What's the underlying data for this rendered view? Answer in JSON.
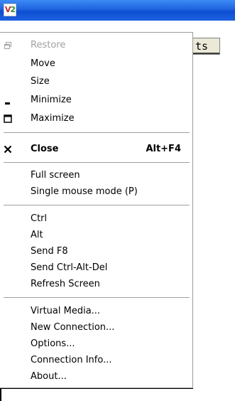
{
  "window": {
    "icon_text_a": "V",
    "icon_text_b": "2",
    "background_button_label": "ts"
  },
  "menu": {
    "restore": "Restore",
    "move": "Move",
    "size": "Size",
    "minimize": "Minimize",
    "maximize": "Maximize",
    "close": "Close",
    "close_shortcut": "Alt+F4",
    "full_screen": "Full screen",
    "single_mouse_mode": "Single mouse mode (P)",
    "ctrl": "Ctrl",
    "alt": "Alt",
    "send_f8": "Send F8",
    "send_ctrl_alt_del": "Send Ctrl-Alt-Del",
    "refresh_screen": "Refresh Screen",
    "virtual_media": "Virtual Media...",
    "new_connection": "New Connection...",
    "options": "Options...",
    "connection_info": "Connection Info...",
    "about": "About..."
  },
  "icons": {
    "restore": "restore-icon",
    "minimize": "minimize-icon",
    "maximize": "maximize-icon",
    "close": "close-icon"
  },
  "colors": {
    "titlebar": "#1f63de",
    "disabled_text": "#a0a0a0",
    "separator": "#a0a0a0"
  }
}
